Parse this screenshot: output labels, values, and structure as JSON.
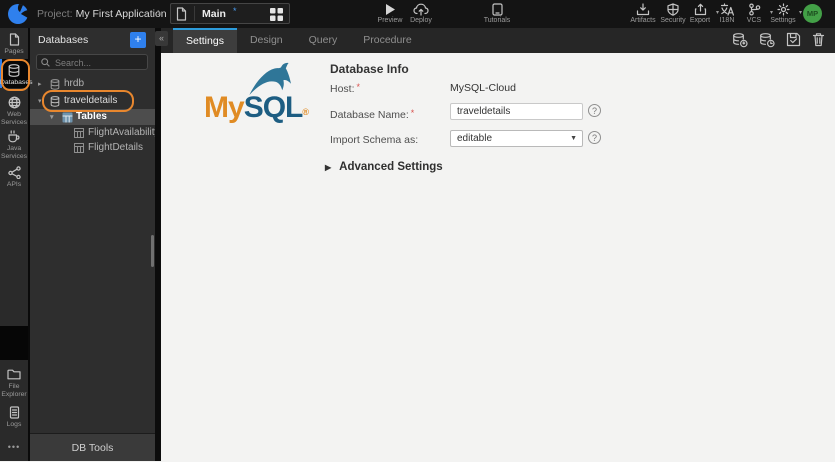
{
  "topbar": {
    "project_label": "Project:",
    "project_name": "My First Application",
    "workspace_name": "Main",
    "unsaved_marker": "*",
    "actions": {
      "preview": "Preview",
      "deploy": "Deploy",
      "tutorials": "Tutorials",
      "artifacts": "Artifacts",
      "security": "Security",
      "export": "Export",
      "i18n": "I18N",
      "vcs": "VCS",
      "settings": "Settings"
    },
    "avatar_initials": "MP"
  },
  "sidebar": {
    "pages": "Pages",
    "databases": "Databases",
    "web_services": "Web Services",
    "java_services": "Java Services",
    "apis": "APIs",
    "file_explorer": "File Explorer",
    "logs": "Logs",
    "more": "•••"
  },
  "panel": {
    "title": "Databases",
    "add_label": "+",
    "collapse_label": "«",
    "search_placeholder": "Search...",
    "tree": {
      "hrdb": "hrdb",
      "traveldetails": "traveldetails",
      "tables": "Tables",
      "flight_availability": "FlightAvailability",
      "flight_details": "FlightDetails"
    },
    "footer": "DB Tools"
  },
  "tabs": {
    "settings": "Settings",
    "design": "Design",
    "query": "Query",
    "procedure": "Procedure"
  },
  "content": {
    "heading": "Database Info",
    "host_label": "Host:",
    "host_value": "MySQL-Cloud",
    "db_name_label": "Database Name:",
    "db_name_value": "traveldetails",
    "import_label": "Import Schema as:",
    "import_value": "editable",
    "advanced_label": "Advanced Settings",
    "required_marker": "*",
    "help_glyph": "?",
    "expander_open": "▾",
    "expander_closed": "▸",
    "advanced_expander": "▶"
  },
  "logo": {
    "my": "My",
    "sql": "SQL",
    "reg": "®"
  },
  "colors": {
    "accent_blue": "#2d9cdb",
    "add_button_blue": "#2f80ed",
    "annotation_orange": "#e8872e",
    "avatar_green": "#43a047",
    "mysql_orange": "#e08b24",
    "mysql_blue": "#1d5d82",
    "content_bg": "#f3f3f2",
    "panel_bg": "#2e2e2e",
    "topbar_bg": "#141414"
  }
}
